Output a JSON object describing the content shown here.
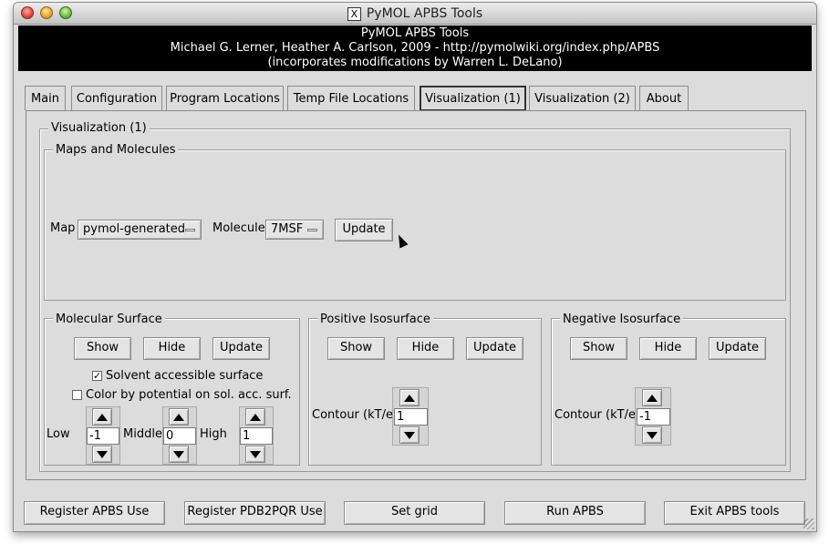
{
  "window": {
    "title": "PyMOL APBS Tools"
  },
  "banner": {
    "line1": "PyMOL APBS Tools",
    "line2": "Michael G. Lerner, Heather A. Carlson, 2009 - http://pymolwiki.org/index.php/APBS",
    "line3": "(incorporates modifications by Warren L. DeLano)"
  },
  "tabs": [
    {
      "label": "Main"
    },
    {
      "label": "Configuration"
    },
    {
      "label": "Program Locations"
    },
    {
      "label": "Temp File Locations"
    },
    {
      "label": "Visualization (1)",
      "active": true
    },
    {
      "label": "Visualization (2)"
    },
    {
      "label": "About"
    }
  ],
  "viz": {
    "group_label": "Visualization (1)",
    "maps": {
      "label": "Maps and Molecules",
      "map_label": "Map",
      "map_value": "pymol-generated",
      "molecule_label": "Molecule",
      "molecule_value": "7MSF",
      "update_label": "Update"
    },
    "molsurf": {
      "label": "Molecular Surface",
      "show": "Show",
      "hide": "Hide",
      "update": "Update",
      "sas_label": "Solvent accessible surface",
      "sas_checked": true,
      "color_label": "Color by potential on sol. acc. surf.",
      "color_checked": false,
      "low_label": "Low",
      "low_value": "-1",
      "middle_label": "Middle",
      "middle_value": "0",
      "high_label": "High",
      "high_value": "1"
    },
    "posiso": {
      "label": "Positive Isosurface",
      "show": "Show",
      "hide": "Hide",
      "update": "Update",
      "contour_label": "Contour (kT/e)",
      "contour_value": "1"
    },
    "negiso": {
      "label": "Negative Isosurface",
      "show": "Show",
      "hide": "Hide",
      "update": "Update",
      "contour_label": "Contour (kT/e)",
      "contour_value": "-1"
    }
  },
  "bottom": {
    "register_apbs": "Register APBS Use",
    "register_pdb2pqr": "Register PDB2PQR Use",
    "set_grid": "Set grid",
    "run_apbs": "Run APBS",
    "exit": "Exit APBS tools"
  }
}
